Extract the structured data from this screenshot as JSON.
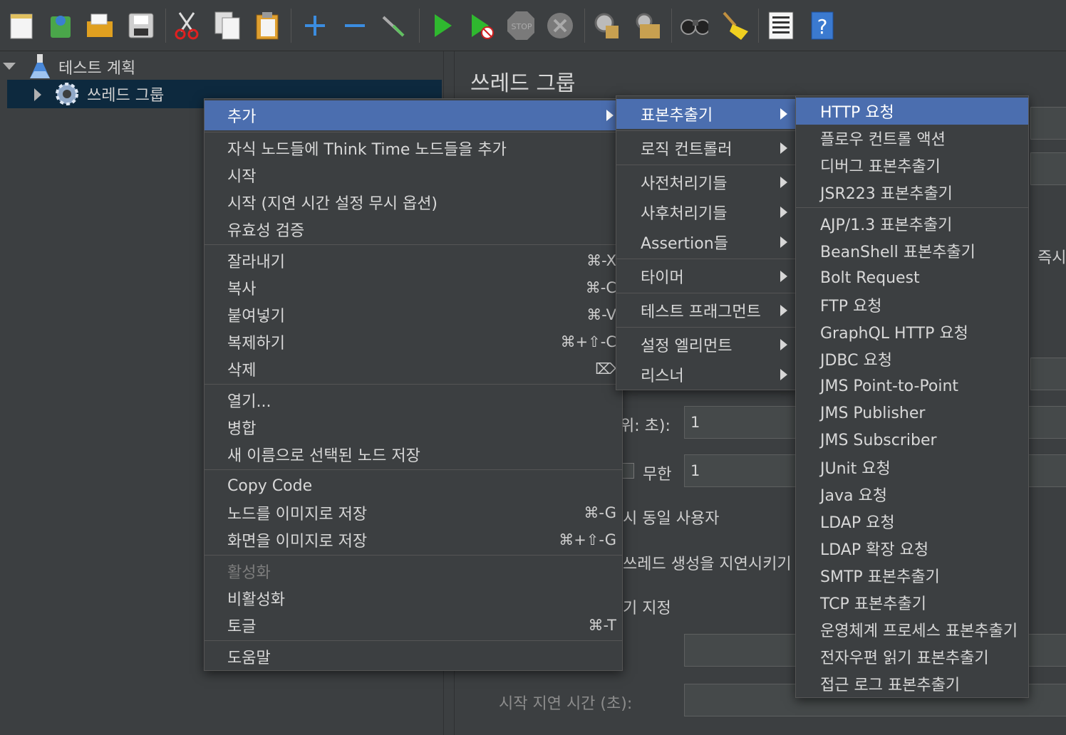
{
  "tree": {
    "root_label": "테스트 계획",
    "child_label": "쓰레드 그룹"
  },
  "panel": {
    "title": "쓰레드 그룹",
    "ramp_label_fragment": "위: 초):",
    "ramp_value": "1",
    "loop_infinite_label": "무한",
    "loop_value": "1",
    "same_user_fragment": "시 동일 사용자",
    "delay_thread_fragment": "쓰레드 생성을 지연시키기",
    "specify_fragment": "기 지정",
    "startup_delay_label": "시작 지연 시간 (초):",
    "immediate_fragment": "즉시"
  },
  "context_menu": {
    "items": [
      {
        "label": "추가",
        "submenu": true
      },
      {
        "label": "자식 노드들에 Think Time 노드들을 추가"
      },
      {
        "label": "시작"
      },
      {
        "label": "시작 (지연 시간 설정 무시 옵션)"
      },
      {
        "label": "유효성 검증"
      },
      {
        "label": "잘라내기",
        "shortcut": "⌘-X"
      },
      {
        "label": "복사",
        "shortcut": "⌘-C"
      },
      {
        "label": "붙여넣기",
        "shortcut": "⌘-V"
      },
      {
        "label": "복제하기",
        "shortcut": "⌘+⇧-C"
      },
      {
        "label": "삭제",
        "shortcut": "⌦"
      },
      {
        "label": "열기..."
      },
      {
        "label": "병합"
      },
      {
        "label": "새 이름으로 선택된 노드 저장"
      },
      {
        "label": "Copy Code"
      },
      {
        "label": "노드를 이미지로 저장",
        "shortcut": "⌘-G"
      },
      {
        "label": "화면을 이미지로 저장",
        "shortcut": "⌘+⇧-G"
      },
      {
        "label": "활성화",
        "disabled": true
      },
      {
        "label": "비활성화"
      },
      {
        "label": "토글",
        "shortcut": "⌘-T"
      },
      {
        "label": "도움말"
      }
    ]
  },
  "add_submenu": {
    "items": [
      {
        "label": "표본추출기"
      },
      {
        "label": "로직 컨트롤러"
      },
      {
        "label": "사전처리기들"
      },
      {
        "label": "사후처리기들"
      },
      {
        "label": "Assertion들"
      },
      {
        "label": "타이머"
      },
      {
        "label": "테스트 프래그먼트"
      },
      {
        "label": "설정 엘리먼트"
      },
      {
        "label": "리스너"
      }
    ]
  },
  "sampler_submenu": {
    "items": [
      {
        "label": "HTTP 요청"
      },
      {
        "label": "플로우 컨트롤 액션"
      },
      {
        "label": "디버그 표본추출기"
      },
      {
        "label": "JSR223 표본추출기"
      },
      {
        "label": "AJP/1.3 표본추출기"
      },
      {
        "label": "BeanShell 표본추출기"
      },
      {
        "label": "Bolt Request"
      },
      {
        "label": "FTP 요청"
      },
      {
        "label": "GraphQL HTTP 요청"
      },
      {
        "label": "JDBC 요청"
      },
      {
        "label": "JMS Point-to-Point"
      },
      {
        "label": "JMS Publisher"
      },
      {
        "label": "JMS Subscriber"
      },
      {
        "label": "JUnit 요청"
      },
      {
        "label": "Java 요청"
      },
      {
        "label": "LDAP 요청"
      },
      {
        "label": "LDAP 확장 요청"
      },
      {
        "label": "SMTP 표본추출기"
      },
      {
        "label": "TCP 표본추출기"
      },
      {
        "label": "운영체계 프로세스 표본추출기"
      },
      {
        "label": "전자우편 읽기 표본추출기"
      },
      {
        "label": "접근 로그 표본추출기"
      }
    ]
  },
  "colors": {
    "background": "#3c3f41",
    "selection": "#4b6eaf",
    "tree_selection": "#0d293e"
  },
  "toolbar_icons": [
    "new-icon",
    "templates-icon",
    "open-icon",
    "save-icon",
    "cut-icon",
    "copy-icon",
    "paste-icon",
    "expand-icon",
    "collapse-icon",
    "toggle-icon",
    "start-icon",
    "start-no-pause-icon",
    "stop-icon",
    "shutdown-icon",
    "clear-icon",
    "clear-all-icon",
    "search-icon",
    "reset-search-icon",
    "function-helper-icon",
    "help-icon"
  ]
}
